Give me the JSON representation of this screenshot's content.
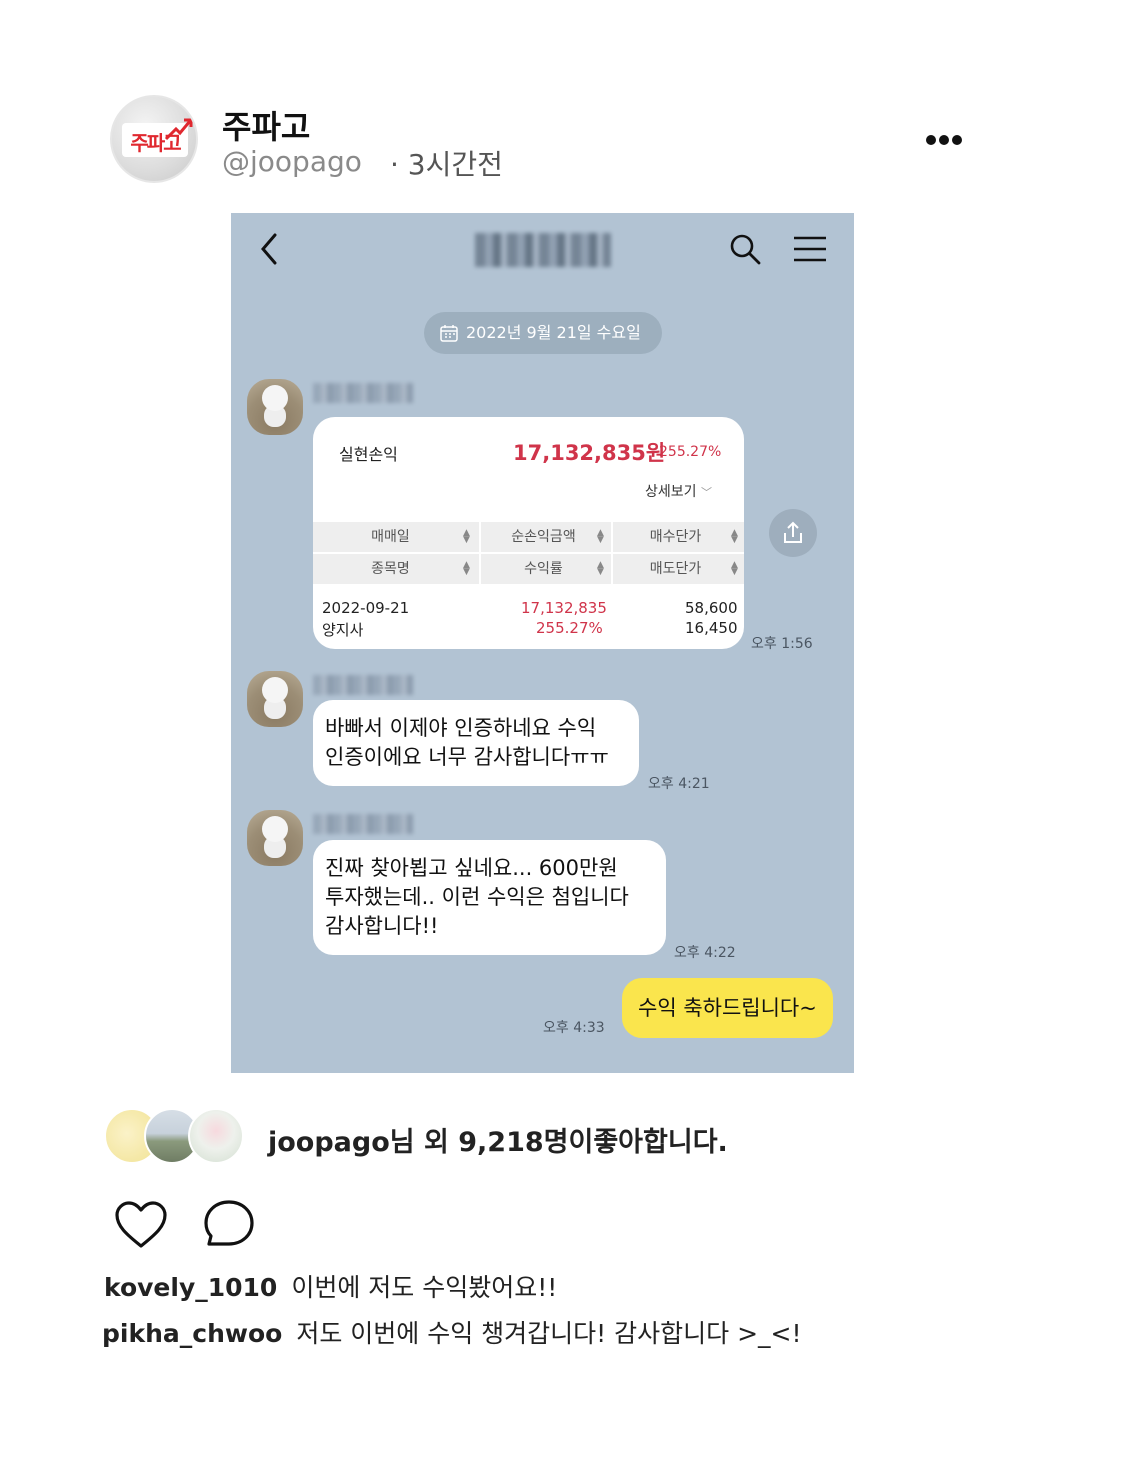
{
  "post": {
    "account_name": "주파고",
    "handle": "@joopago",
    "time": "· 3시간전",
    "logo_text": "주파고"
  },
  "chat": {
    "date": "2022년 9월 21일 수요일",
    "card": {
      "label": "실현손익",
      "amount": "17,132,835원",
      "percent": "255.27%",
      "detail": "상세보기",
      "headers_row1": [
        "매매일",
        "순손익금액",
        "매수단가"
      ],
      "headers_row2": [
        "종목명",
        "수익률",
        "매도단가"
      ],
      "row1": [
        "2022-09-21",
        "17,132,835",
        "58,600"
      ],
      "row2": [
        "양지사",
        "255.27%",
        "16,450"
      ],
      "time": "오후 1:56"
    },
    "messages": [
      {
        "text_line1": "바빠서 이제야 인증하네요 수익",
        "text_line2": "인증이에요 너무 감사합니다ㅠㅠ",
        "time": "오후 4:21"
      },
      {
        "text_line1": "진짜 찾아뵙고 싶네요... 600만원",
        "text_line2": "투자했는데.. 이런 수익은 첨입니다",
        "text_line3": "감사합니다!!",
        "time": "오후 4:22"
      }
    ],
    "reply": {
      "text": "수익 축하드립니다~",
      "time": "오후 4:33"
    }
  },
  "likes": {
    "text": "joopago님 외 9,218명이좋아합니다."
  },
  "comments": [
    {
      "user": "kovely_1010",
      "text": "이번에 저도 수익봤어요!!"
    },
    {
      "user": "pikha_chwoo",
      "text": "저도 이번에 수익 챙겨갑니다! 감사합니다 >_<!"
    }
  ],
  "colors": {
    "chat_bg": "#b2c3d3",
    "reply_bubble": "#fae54d",
    "profit_red": "#d0344a"
  },
  "icons": [
    "more-icon",
    "back-icon",
    "search-icon",
    "menu-icon",
    "calendar-icon",
    "share-icon",
    "heart-icon",
    "comment-icon"
  ]
}
